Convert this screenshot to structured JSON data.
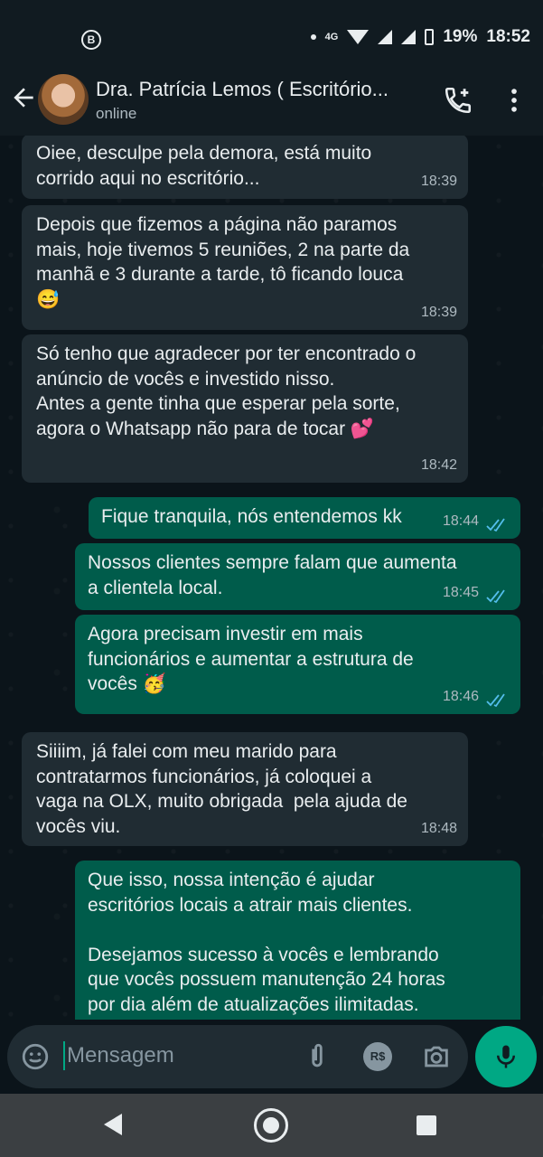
{
  "status_bar": {
    "left_icon": "B",
    "network": "4G",
    "battery": "19%",
    "time": "18:52"
  },
  "header": {
    "contact_name": "Dra. Patrícia Lemos ( Escritório...",
    "status": "online"
  },
  "messages": [
    {
      "dir": "in",
      "text": "Oiee, desculpe pela demora, está muito\ncorrido aqui no escritório...",
      "time": "18:39"
    },
    {
      "dir": "in",
      "text": "Depois que fizemos a página não paramos\nmais, hoje tivemos 5 reuniões, 2 na parte da\nmanhã e 3 durante a tarde, tô ficando louca\n😅",
      "time": "18:39"
    },
    {
      "dir": "in",
      "text": "Só tenho que agradecer por ter encontrado o\nanúncio de vocês e investido nisso.\nAntes a gente tinha que esperar pela sorte,\nagora o Whatsapp não para de tocar 💕",
      "time": "18:42"
    },
    {
      "dir": "out",
      "text": "Fique tranquila, nós entendemos kk",
      "time": "18:44"
    },
    {
      "dir": "out",
      "text": "Nossos clientes sempre falam que aumenta\na clientela local.",
      "time": "18:45"
    },
    {
      "dir": "out",
      "text": "Agora precisam investir em mais\nfuncionários e aumentar a estrutura de\nvocês 🥳",
      "time": "18:46"
    },
    {
      "dir": "in",
      "text": "Siiiim, já falei com meu marido para\ncontratarmos funcionários, já coloquei a\nvaga na OLX, muito obrigada  pela ajuda de\nvocês viu.",
      "time": "18:48"
    },
    {
      "dir": "out",
      "text": "Que isso, nossa intenção é ajudar\nescritórios locais a atrair mais clientes.\n\nDesejamos sucesso à vocês e lembrando\nque vocês possuem manutenção 24 horas\npor dia além de atualizações ilimitadas.",
      "time": ""
    }
  ],
  "input": {
    "placeholder": "Mensagem",
    "currency_label": "R$"
  },
  "colors": {
    "incoming": "#202c33",
    "outgoing": "#005c4b",
    "accent": "#00a884",
    "read_ticks": "#53bdeb"
  },
  "icons": [
    "back-arrow-icon",
    "add-call-icon",
    "more-vert-icon",
    "emoji-icon",
    "attach-icon",
    "payment-icon",
    "camera-icon",
    "mic-icon",
    "double-check-icon"
  ]
}
